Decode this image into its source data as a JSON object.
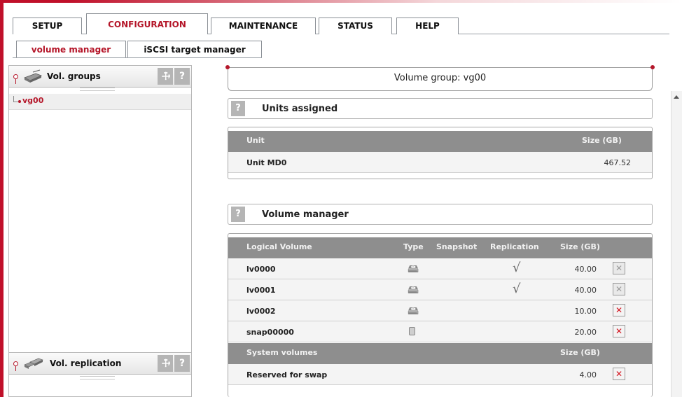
{
  "colors": {
    "brand": "#b5172a",
    "header_gray": "#8e8e8e",
    "row_bg": "#f4f4f4",
    "delete_red": "#d4141f"
  },
  "main_tabs": [
    {
      "label": "SETUP"
    },
    {
      "label": "CONFIGURATION",
      "active": true
    },
    {
      "label": "MAINTENANCE"
    },
    {
      "label": "STATUS"
    },
    {
      "label": "HELP"
    }
  ],
  "sub_tabs": [
    {
      "label": "volume manager",
      "active": true
    },
    {
      "label": "iSCSI target manager"
    }
  ],
  "left_panel": {
    "groups_title": "Vol. groups",
    "groups_icon": "hard-drive-icon",
    "settings_icon": "wrench-icon",
    "help_label": "?",
    "tree": [
      {
        "label": "vg00",
        "selected": true
      }
    ],
    "replication_title": "Vol. replication",
    "replication_icon": "replication-drives-icon"
  },
  "main": {
    "volume_group_title": "Volume group: vg00",
    "units_section": {
      "help_label": "?",
      "title": "Units assigned",
      "headers": {
        "unit": "Unit",
        "size": "Size (GB)"
      },
      "rows": [
        {
          "unit": "Unit MD0",
          "size": "467.52"
        }
      ]
    },
    "volume_section": {
      "help_label": "?",
      "title": "Volume manager",
      "headers": {
        "name": "Logical Volume",
        "type": "Type",
        "snapshot": "Snapshot",
        "replication": "Replication",
        "size": "Size (GB)"
      },
      "rows": [
        {
          "name": "lv0000",
          "type_icon": "lv-icon",
          "replication": "√",
          "size": "40.00",
          "delete_enabled": false
        },
        {
          "name": "lv0001",
          "type_icon": "lv-icon",
          "replication": "√",
          "size": "40.00",
          "delete_enabled": false
        },
        {
          "name": "lv0002",
          "type_icon": "lv-icon",
          "replication": "",
          "size": "10.00",
          "delete_enabled": true
        },
        {
          "name": "snap00000",
          "type_icon": "snapshot-icon",
          "replication": "",
          "size": "20.00",
          "delete_enabled": true
        }
      ],
      "system_headers": {
        "name": "System volumes",
        "size": "Size (GB)"
      },
      "system_rows": [
        {
          "name": "Reserved for swap",
          "size": "4.00",
          "delete_enabled": true
        }
      ],
      "delete_label": "✕"
    }
  }
}
